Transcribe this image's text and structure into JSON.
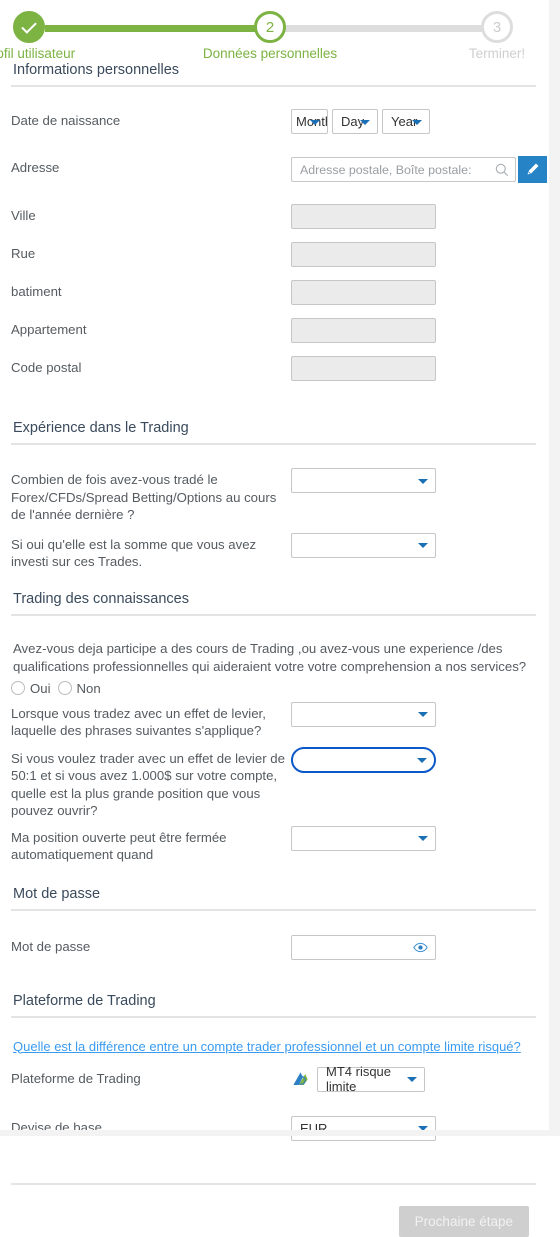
{
  "stepper": {
    "steps": [
      {
        "label": "Profil utilisateur",
        "marker": "check",
        "state": "done"
      },
      {
        "label": "Données personnelles",
        "marker": "2",
        "state": "current"
      },
      {
        "label": "Terminer!",
        "marker": "3",
        "state": "todo"
      }
    ],
    "colors": {
      "done": "#7cb342",
      "todo": "#dddddd"
    }
  },
  "sections": {
    "personal": {
      "title": "Informations personnelles",
      "birthdate_label": "Date de naissance",
      "birthdate": {
        "month": "Month",
        "day": "Day",
        "year": "Year"
      },
      "address_label": "Adresse",
      "address_placeholder": "Adresse postale, Boîte postale:",
      "fields": [
        {
          "label": "Ville",
          "value": ""
        },
        {
          "label": "Rue",
          "value": ""
        },
        {
          "label": "batiment",
          "value": ""
        },
        {
          "label": "Appartement",
          "value": ""
        },
        {
          "label": "Code postal",
          "value": ""
        }
      ]
    },
    "experience": {
      "title": "Expérience dans le Trading",
      "questions": [
        {
          "label": "Combien de fois avez-vous tradé le Forex/CFDs/Spread Betting/Options au cours de l'année dernière ?",
          "value": ""
        },
        {
          "label": "Si oui qu'elle est la somme que vous avez investi sur ces Trades.",
          "value": ""
        }
      ]
    },
    "knowledge": {
      "title": "Trading des connaissances",
      "intro": "Avez-vous deja participe a des cours de Trading ,ou avez-vous une experience /des qualifications professionnelles qui aideraient votre votre comprehension a nos services?",
      "radio_yes": "Oui",
      "radio_no": "Non",
      "questions": [
        {
          "label": "Lorsque vous tradez avec un effet de levier, laquelle des phrases suivantes s'applique?",
          "value": "",
          "focused": false
        },
        {
          "label": "Si vous voulez trader avec un effet de levier de 50:1 et si vous avez 1.000$ sur votre compte, quelle est la plus grande position que vous pouvez ouvrir?",
          "value": "",
          "focused": true
        },
        {
          "label": "Ma position ouverte peut être fermée automatiquement quand",
          "value": "",
          "focused": false
        }
      ]
    },
    "password": {
      "title": "Mot de passe",
      "label": "Mot de passe",
      "value": ""
    },
    "platform": {
      "title": "Plateforme de Trading",
      "link": "Quelle est la différence entre un compte trader professionnel et un compte limite risqué?",
      "platform_label": "Plateforme de Trading",
      "platform_value": "MT4 risque limite",
      "currency_label": "Devise de base",
      "currency_value": "EUR"
    }
  },
  "footer": {
    "next_button": "Prochaine étape",
    "next_button_disabled": true
  },
  "icons": {
    "search": "search-icon",
    "edit": "pencil-icon",
    "eye": "eye-icon",
    "platform_logo": "metatrader-logo-icon"
  },
  "colors": {
    "accent_green": "#7cb342",
    "accent_blue": "#2583c6",
    "link_blue": "#3b9bf0",
    "focus_blue": "#0b58c8"
  }
}
